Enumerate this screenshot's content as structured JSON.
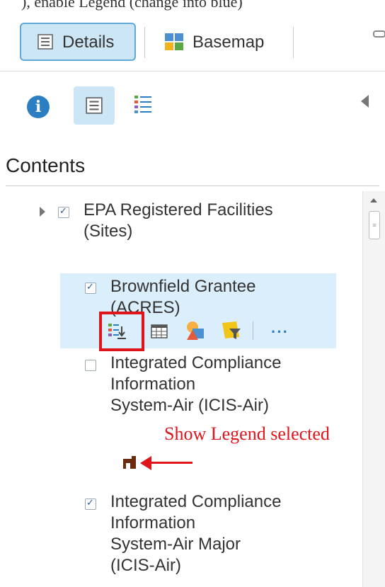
{
  "top_caption": "), enable Legend (change into blue)",
  "toolbar": {
    "details_label": "Details",
    "basemap_label": "Basemap"
  },
  "secondary_tabs": [
    "about",
    "content",
    "legend"
  ],
  "contents": {
    "title": "Contents"
  },
  "layers": [
    {
      "label_line1": "EPA Registered Facilities",
      "label_line2": "(Sites)",
      "checked": true,
      "expandable": true
    },
    {
      "label_line1": "Brownfield Grantee",
      "label_line2": "(ACRES)",
      "checked": true,
      "selected": true
    },
    {
      "label_line1": "Integrated Compliance",
      "label_line2": "Information",
      "label_line3": "System-Air (ICIS-Air)",
      "checked": false
    },
    {
      "label_line1": "Integrated Compliance",
      "label_line2": "Information",
      "label_line3": "System-Air Major",
      "label_line4": "(ICIS-Air)",
      "checked": true
    }
  ],
  "layer_tools": [
    "show-legend",
    "show-table",
    "change-style",
    "filter",
    "more-options"
  ],
  "more_label": "···",
  "annotation": {
    "text": "Show Legend selected",
    "color": "#e0141b"
  },
  "colors": {
    "accent": "#2c7ec3",
    "selected_bg": "#cde6f6",
    "highlight": "#e0141b"
  }
}
